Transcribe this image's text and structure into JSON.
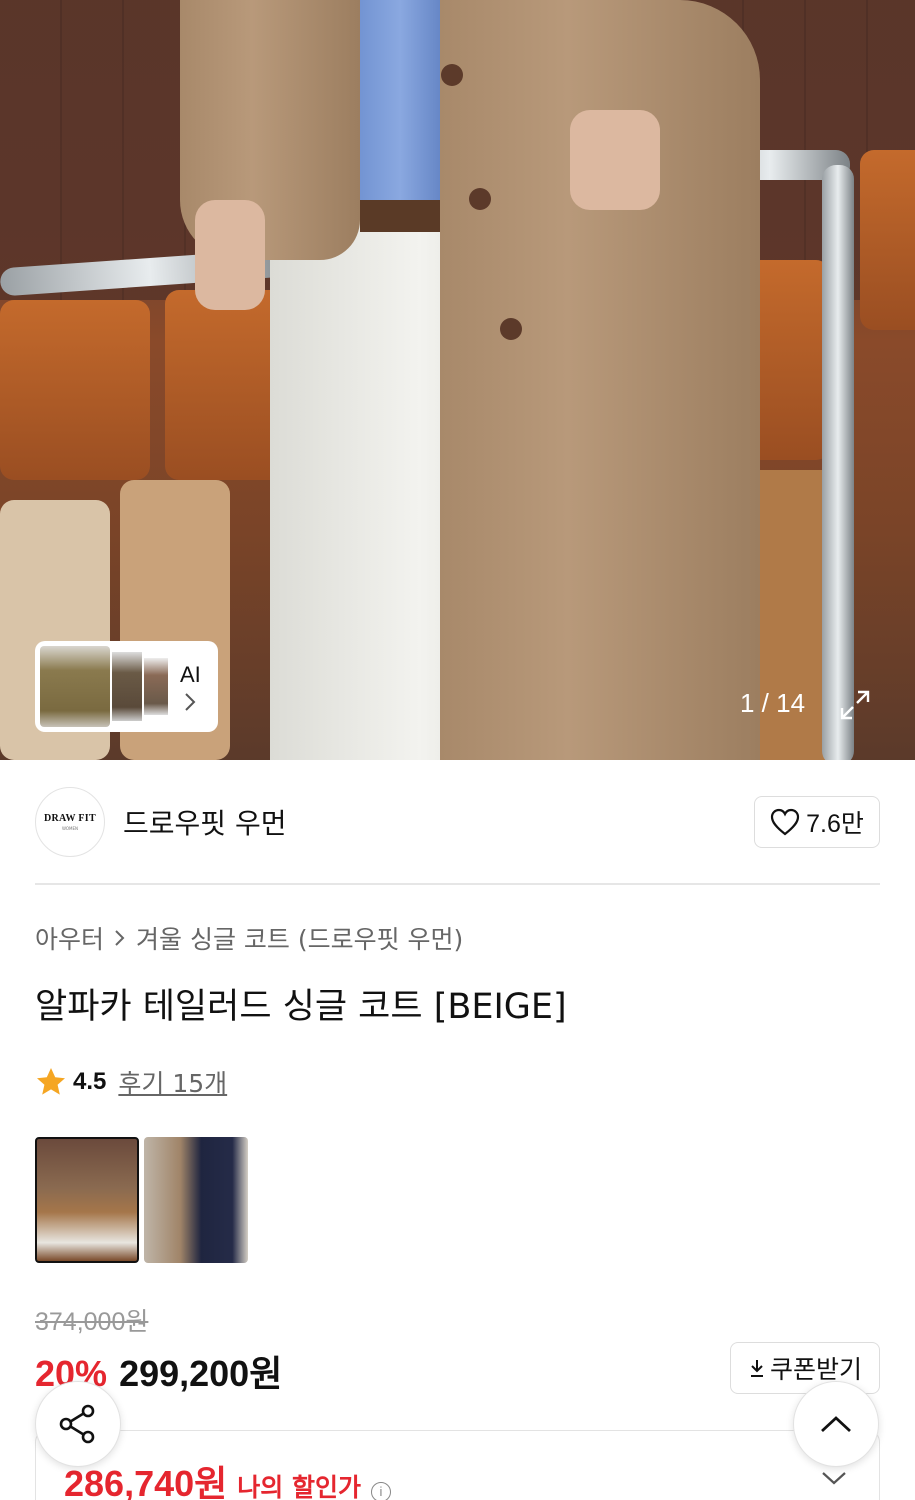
{
  "gallery": {
    "counter": "1 / 14",
    "ai_label": "AI"
  },
  "brand": {
    "logo_line1": "DRAW FIT",
    "logo_line2": "WOMEN",
    "name": "드로우핏 우먼",
    "likes": "7.6만"
  },
  "breadcrumb": {
    "category": "아우터",
    "subcategory": "겨울 싱글 코트 (드로우핏 우먼)"
  },
  "product": {
    "title": "알파카 테일러드 싱글 코트 [BEIGE]",
    "rating": "4.5",
    "reviews": "후기 15개"
  },
  "price": {
    "original": "374,000원",
    "discount": "20%",
    "sale": "299,200원",
    "coupon_label": "쿠폰받기",
    "my_price": "286,740원",
    "my_price_label": "나의 할인가"
  },
  "colors": {
    "accent": "#e5262f",
    "star": "#f5a623"
  }
}
